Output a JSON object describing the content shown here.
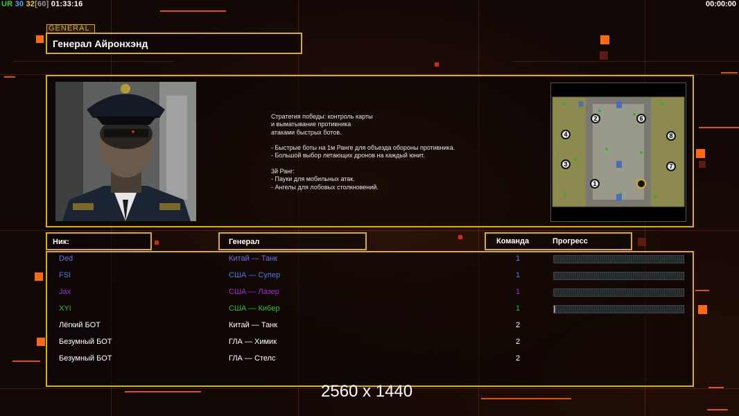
{
  "hud": {
    "left_ur": "UR",
    "left_n1": "30",
    "left_n2": "32",
    "left_n3": "[60]",
    "left_time": "01:33:16",
    "right_time": "00:00:00"
  },
  "general": {
    "tag": "GENERAL",
    "name": "Генерал Айронхэнд",
    "description": "Стратегия победы: контроль карты\nи выматывание противника\nатаками быстрых ботов.\n\n- Быстрые боты на 1м Ранге для объезда обороны противника.\n- Большой выбор летающих дронов на каждый юнит.\n\n3й Ранг:\n- Пауки для мобильных атак.\n- Ангелы для лобовых столкновений."
  },
  "minimap": {
    "slots": [
      "2",
      "6",
      "4",
      "8",
      "3",
      "7",
      "1",
      ""
    ]
  },
  "table": {
    "headers": {
      "nick": "Ник:",
      "general": "Генерал",
      "team": "Команда",
      "progress": "Прогресс"
    },
    "rows": [
      {
        "nick": "Ded",
        "general": "Китай — Танк",
        "team": "1",
        "color": "#6f70e6",
        "progress": 0.0
      },
      {
        "nick": "FSI",
        "general": "США — Супер",
        "team": "1",
        "color": "#4a7be8",
        "progress": 0.0
      },
      {
        "nick": "Jax",
        "general": "США — Лазер",
        "team": "1",
        "color": "#a02ad8",
        "progress": 0.0
      },
      {
        "nick": "XYI",
        "general": "США — Кибер",
        "team": "1",
        "color": "#2fc02f",
        "progress": 0.01
      },
      {
        "nick": "Лёгкий БОТ",
        "general": "Китай — Танк",
        "team": "2",
        "color": "#ffffff"
      },
      {
        "nick": "Безумный БОТ",
        "general": "ГЛА — Химик",
        "team": "2",
        "color": "#ffffff"
      },
      {
        "nick": "Безумный БОТ",
        "general": "ГЛА — Стелс",
        "team": "2",
        "color": "#ffffff"
      }
    ]
  },
  "overlay": {
    "resolution": "2560 x 1440"
  },
  "colors": {
    "accent": "#d9ae1c",
    "deco_orange": "#ff6a10",
    "background": "#120806"
  }
}
